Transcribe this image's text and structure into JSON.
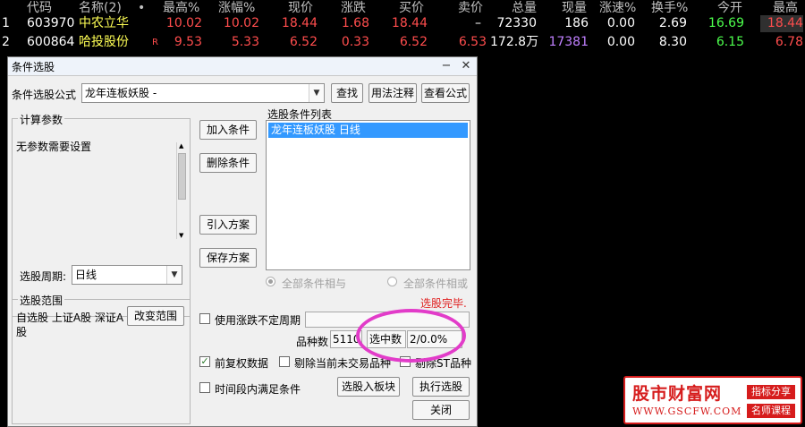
{
  "quotes": {
    "headers": [
      "代码",
      "名称(2)",
      "•",
      "最高%",
      "涨幅%",
      "现价",
      "涨跌",
      "买价",
      "卖价",
      "总量",
      "现量",
      "涨速%",
      "换手%",
      "今开",
      "最高"
    ],
    "rows": [
      {
        "idx": "1",
        "code": "603970",
        "name": "中农立华",
        "flag": "",
        "high_pct": "10.02",
        "chg_pct": "10.02",
        "price": "18.44",
        "change": "1.68",
        "bid": "18.44",
        "ask": "–",
        "volume": "72330",
        "cur_vol": "186",
        "speed": "0.00",
        "turnover": "2.69",
        "open": "16.69",
        "high": "18.44"
      },
      {
        "idx": "2",
        "code": "600864",
        "name": "哈投股份",
        "flag": "R",
        "high_pct": "9.53",
        "chg_pct": "5.33",
        "price": "6.52",
        "change": "0.33",
        "bid": "6.52",
        "ask": "6.53",
        "volume": "172.8万",
        "cur_vol": "17381",
        "speed": "0.00",
        "turnover": "8.30",
        "open": "6.15",
        "high": "6.78"
      }
    ]
  },
  "dialog": {
    "title": "条件选股",
    "formula_label": "条件选股公式",
    "formula_value": "龙年连板妖股  -",
    "find_button": "查找",
    "usage_button": "用法注释",
    "view_button": "查看公式",
    "params_group": "计算参数",
    "params_text": "无参数需要设置",
    "add_condition": "加入条件",
    "delete_condition": "删除条件",
    "import_plan": "引入方案",
    "save_plan": "保存方案",
    "cond_list_label": "选股条件列表",
    "cond_list_items": [
      "龙年连板妖股  日线"
    ],
    "period_label": "选股周期:",
    "period_value": "日线",
    "radio_and": "全部条件相与",
    "radio_or": "全部条件相或",
    "status": "选股完毕.",
    "range_group": "选股范围",
    "range_text": "自选股 上证A股 深证A股",
    "change_range": "改变范围",
    "use_period_label": "使用涨跌不定周期",
    "count_label": "品种数",
    "count_value": "5110",
    "selected_label": "选中数",
    "selected_value": "2/0.0%",
    "restore_label": "前复权数据",
    "exclude_untraded": "剔除当前未交易品种",
    "exclude_st": "剔除ST品种",
    "time_cond": "时间段内满足条件",
    "to_block": "选股入板块",
    "execute": "执行选股",
    "close": "关闭"
  },
  "watermark": {
    "name": "股市财富网",
    "url": "WWW.GSCFW.COM",
    "tag1": "指标分享",
    "tag2": "名师课程"
  },
  "colors": {
    "up": "#ff4d4d",
    "down": "#4dff4d",
    "highlight_circle": "#e23cc9",
    "selection": "#3399ff"
  }
}
